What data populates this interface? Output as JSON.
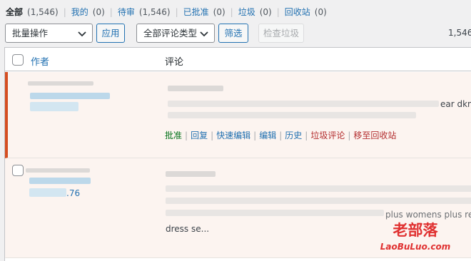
{
  "filters": [
    {
      "label": "全部",
      "count": "(1,546)",
      "current": true
    },
    {
      "label": "我的",
      "count": "(0)"
    },
    {
      "label": "待审",
      "count": "(1,546)"
    },
    {
      "label": "已批准",
      "count": "(0)"
    },
    {
      "label": "垃圾",
      "count": "(0)"
    },
    {
      "label": "回收站",
      "count": "(0)"
    }
  ],
  "toolbar": {
    "bulk_action_value": "批量操作",
    "apply_label": "应用",
    "comment_type_value": "全部评论类型",
    "filter_label": "筛选",
    "empty_spam_label": "检查垃圾",
    "items_count": "1,546"
  },
  "table": {
    "columns": [
      "作者",
      "评论"
    ],
    "rows": [
      {
        "comment_tail": "ear dkny",
        "actions": [
          "批准",
          "回复",
          "快速编辑",
          "编辑",
          "历史",
          "垃圾评论",
          "移至回收站"
        ]
      },
      {
        "author_tail": ".76",
        "comment_tail_1": "plus womens plus red",
        "comment_tail_2": "dress se..."
      }
    ]
  },
  "watermark": {
    "cn": "老部落",
    "en": "LaoBuLuo.com"
  },
  "colors": {
    "accent": "#2271b1",
    "approve": "#007017",
    "danger": "#b32d2e",
    "unapproved_bar": "#d54e21",
    "unapproved_bg": "#fcf4f0"
  }
}
